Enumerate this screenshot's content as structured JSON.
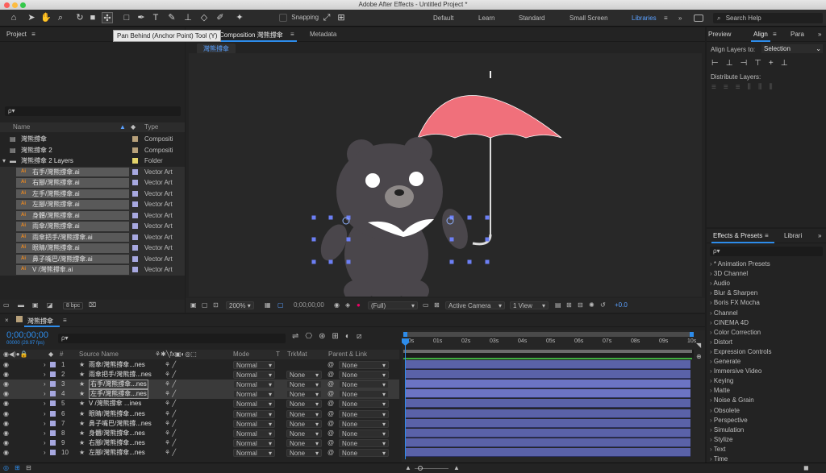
{
  "app": {
    "title": "Adobe After Effects - Untitled Project *"
  },
  "toolbar": {
    "snapping_label": "Snapping",
    "workspaces": [
      "Default",
      "Learn",
      "Standard",
      "Small Screen",
      "Libraries"
    ],
    "active_workspace": "Libraries",
    "search_help": "Search Help",
    "tooltip": "Pan Behind (Anchor Point) Tool (Y)"
  },
  "project_panel": {
    "title": "Project",
    "search_placeholder": "ρ▾",
    "columns": {
      "name": "Name",
      "type": "Type"
    },
    "bpc": "8 bpc",
    "items": [
      {
        "name": "灣熊撐傘",
        "type": "Compositi",
        "indent": 0,
        "icon": "comp",
        "color": "#b7a07a"
      },
      {
        "name": "灣熊撐傘 2",
        "type": "Compositi",
        "indent": 0,
        "icon": "comp",
        "color": "#b7a07a"
      },
      {
        "name": "灣熊撐傘 2 Layers",
        "type": "Folder",
        "indent": 0,
        "icon": "folder",
        "color": "#e3d36b"
      },
      {
        "name": "右手/灣熊撐傘.ai",
        "type": "Vector Art",
        "indent": 1,
        "icon": "ai",
        "color": "#a7a8e0"
      },
      {
        "name": "右腳/灣熊撐傘.ai",
        "type": "Vector Art",
        "indent": 1,
        "icon": "ai",
        "color": "#a7a8e0"
      },
      {
        "name": "左手/灣熊撐傘.ai",
        "type": "Vector Art",
        "indent": 1,
        "icon": "ai",
        "color": "#a7a8e0"
      },
      {
        "name": "左腳/灣熊撐傘.ai",
        "type": "Vector Art",
        "indent": 1,
        "icon": "ai",
        "color": "#a7a8e0"
      },
      {
        "name": "身體/灣熊撐傘.ai",
        "type": "Vector Art",
        "indent": 1,
        "icon": "ai",
        "color": "#a7a8e0"
      },
      {
        "name": "雨傘/灣熊撐傘.ai",
        "type": "Vector Art",
        "indent": 1,
        "icon": "ai",
        "color": "#a7a8e0"
      },
      {
        "name": "雨傘把手/灣熊撐傘.ai",
        "type": "Vector Art",
        "indent": 1,
        "icon": "ai",
        "color": "#a7a8e0"
      },
      {
        "name": "眼睛/灣熊撐傘.ai",
        "type": "Vector Art",
        "indent": 1,
        "icon": "ai",
        "color": "#a7a8e0"
      },
      {
        "name": "鼻子嘴巴/灣熊撐傘.ai",
        "type": "Vector Art",
        "indent": 1,
        "icon": "ai",
        "color": "#a7a8e0"
      },
      {
        "name": "V /灣熊撐傘.ai",
        "type": "Vector Art",
        "indent": 1,
        "icon": "ai",
        "color": "#a7a8e0"
      }
    ]
  },
  "comp_panel": {
    "tab_prefix": "Composition",
    "tab_name": "灣熊撐傘",
    "metadata_tab": "Metadata",
    "breadcrumb": "灣熊撐傘",
    "zoom": "200%",
    "timecode": "0;00;00;00",
    "resolution": "(Full)",
    "camera": "Active Camera",
    "views": "1 View",
    "exposure": "+0.0"
  },
  "right_panel": {
    "tabs": [
      "Preview",
      "Align",
      "Para"
    ],
    "align_to_label": "Align Layers to:",
    "align_to_value": "Selection",
    "distribute_label": "Distribute Layers:",
    "effects_tab": "Effects & Presets",
    "libraries_tab": "Librari",
    "effects_search": "ρ▾",
    "categories": [
      "* Animation Presets",
      "3D Channel",
      "Audio",
      "Blur & Sharpen",
      "Boris FX Mocha",
      "Channel",
      "CINEMA 4D",
      "Color Correction",
      "Distort",
      "Expression Controls",
      "Generate",
      "Immersive Video",
      "Keying",
      "Matte",
      "Noise & Grain",
      "Obsolete",
      "Perspective",
      "Simulation",
      "Stylize",
      "Text",
      "Time"
    ]
  },
  "timeline": {
    "tab_name": "灣熊撐傘",
    "timecode": "0;00;00;00",
    "fps": "00000 (29.97 fps)",
    "search_placeholder": "ρ▾",
    "columns": {
      "num": "#",
      "source": "Source Name",
      "mode": "Mode",
      "t": "T",
      "trkmat": "TrkMat",
      "parent": "Parent & Link"
    },
    "ruler": [
      "00s",
      "01s",
      "02s",
      "03s",
      "04s",
      "05s",
      "06s",
      "07s",
      "08s",
      "09s",
      "10s"
    ],
    "layers": [
      {
        "num": "1",
        "name": "雨傘/灣熊撐傘...nes",
        "mode": "Normal",
        "trkmat": "",
        "parent": "None",
        "selected": false
      },
      {
        "num": "2",
        "name": "雨傘把手/灣熊撐...nes",
        "mode": "Normal",
        "trkmat": "None",
        "parent": "None",
        "selected": false
      },
      {
        "num": "3",
        "name": "右手/灣熊撐傘...nes",
        "mode": "Normal",
        "trkmat": "None",
        "parent": "None",
        "selected": true
      },
      {
        "num": "4",
        "name": "左手/灣熊撐傘...nes",
        "mode": "Normal",
        "trkmat": "None",
        "parent": "None",
        "selected": true
      },
      {
        "num": "5",
        "name": "V /灣熊撐傘 ...ines",
        "mode": "Normal",
        "trkmat": "None",
        "parent": "None",
        "selected": false
      },
      {
        "num": "6",
        "name": "眼睛/灣熊撐傘...nes",
        "mode": "Normal",
        "trkmat": "None",
        "parent": "None",
        "selected": false
      },
      {
        "num": "7",
        "name": "鼻子嘴巴/灣熊撐...nes",
        "mode": "Normal",
        "trkmat": "None",
        "parent": "None",
        "selected": false
      },
      {
        "num": "8",
        "name": "身體/灣熊撐傘...nes",
        "mode": "Normal",
        "trkmat": "None",
        "parent": "None",
        "selected": false
      },
      {
        "num": "9",
        "name": "右腳/灣熊撐傘...nes",
        "mode": "Normal",
        "trkmat": "None",
        "parent": "None",
        "selected": false
      },
      {
        "num": "10",
        "name": "左腳/灣熊撐傘...nes",
        "mode": "Normal",
        "trkmat": "None",
        "parent": "None",
        "selected": false
      }
    ]
  },
  "colors": {
    "accent": "#2d8ceb",
    "umbrella": "#f0707b",
    "bear": "#4a464b",
    "track": "#5a62a8"
  }
}
